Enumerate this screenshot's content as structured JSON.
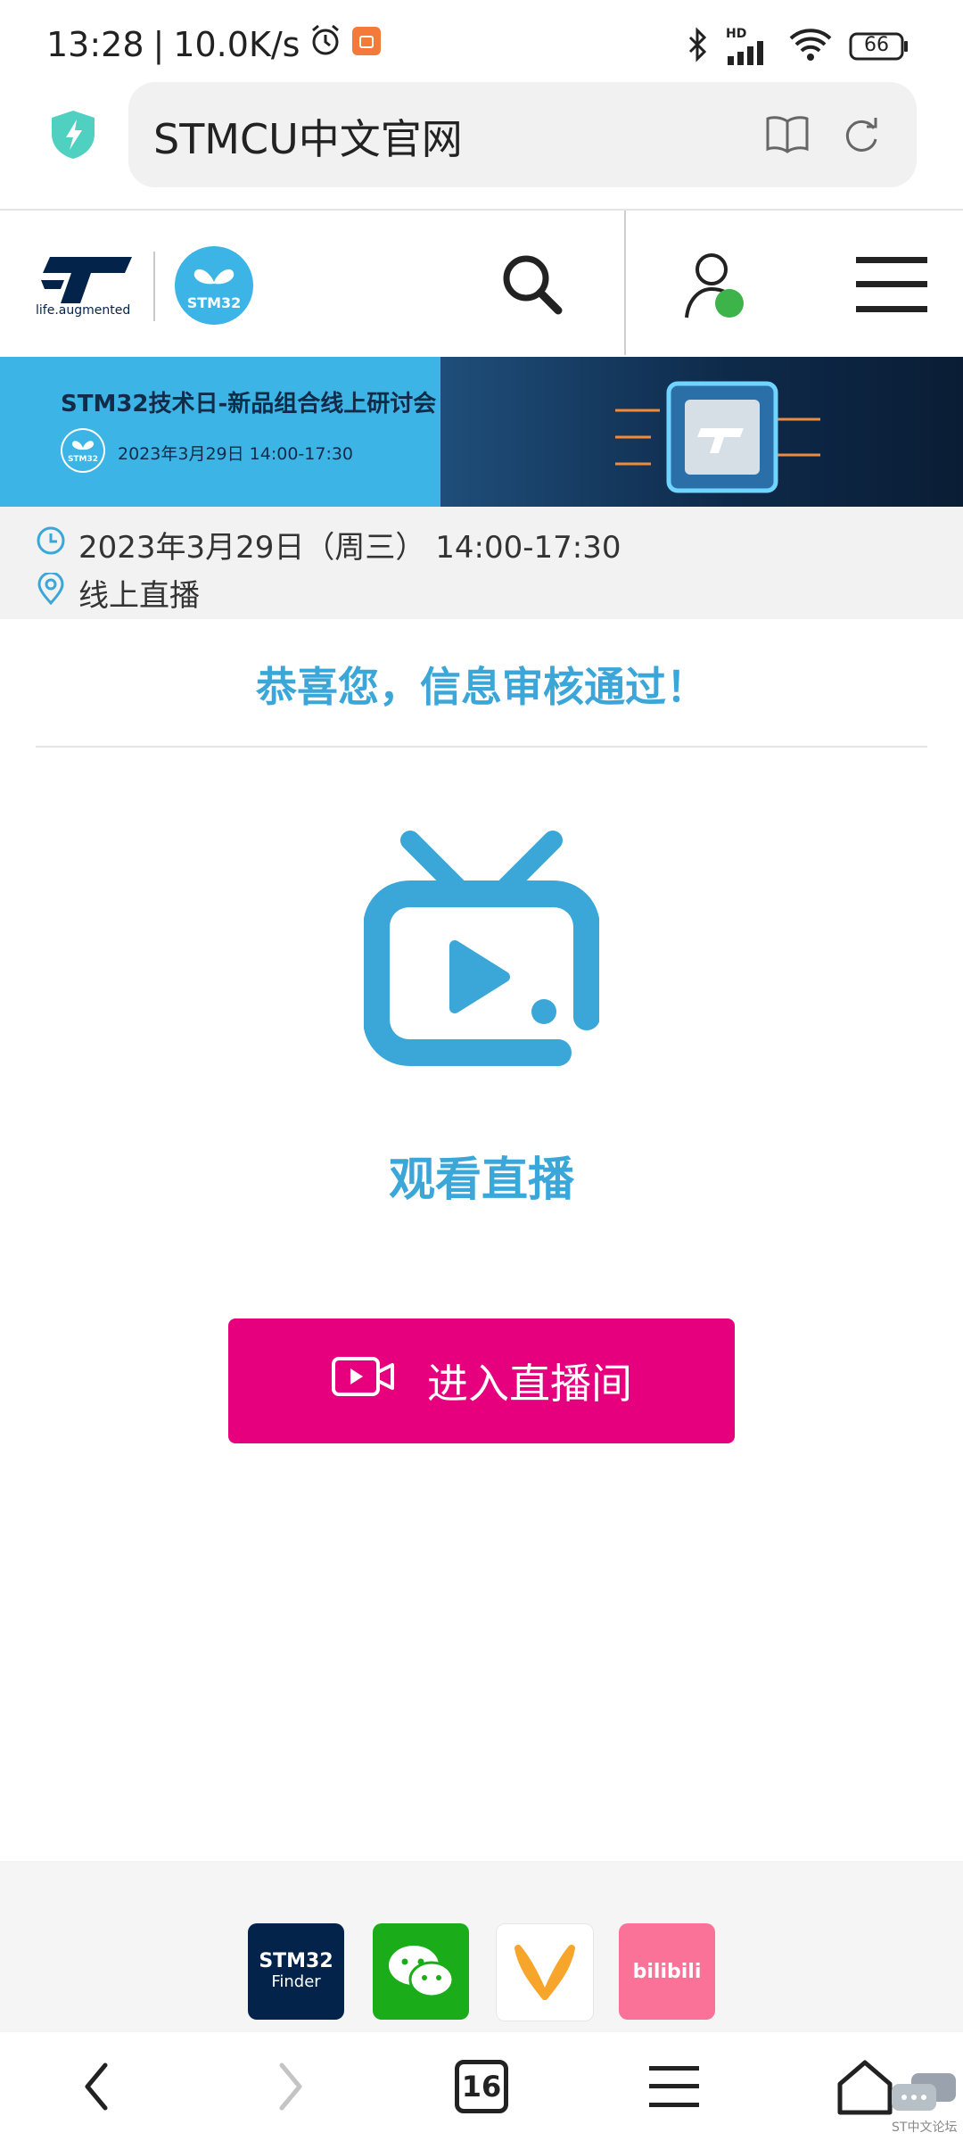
{
  "status_bar": {
    "time": "13:28",
    "speed": "10.0K/s",
    "battery": "66",
    "network": "HD"
  },
  "browser": {
    "url_text": "STMCU中文官网"
  },
  "site": {
    "logo_tagline": "life.augmented",
    "stm_badge": "STM32"
  },
  "banner": {
    "title": "STM32技术日-新品组合线上研讨会",
    "date": "2023年3月29日 14:00-17:30",
    "badge": "STM32"
  },
  "event": {
    "datetime": "2023年3月29日（周三） 14:00-17:30",
    "location": "线上直播"
  },
  "main": {
    "success_message": "恭喜您，信息审核通过！",
    "watch_label": "观看直播",
    "enter_button": "进入直播间"
  },
  "apps": [
    {
      "name": "STM32 Finder",
      "line1": "STM32",
      "line2": "Finder",
      "color": "#03234b"
    },
    {
      "name": "WeChat",
      "color": "#1aad19"
    },
    {
      "name": "Miao",
      "color": "#ffffff"
    },
    {
      "name": "bilibili",
      "label": "bilibili",
      "color": "#fb7299"
    }
  ],
  "bottom_nav": {
    "tabs_count": "16"
  },
  "watermark": "ST中文论坛",
  "colors": {
    "accent_blue": "#3ba6d8",
    "button_pink": "#e6007e",
    "banner_blue": "#3cb4e5"
  }
}
